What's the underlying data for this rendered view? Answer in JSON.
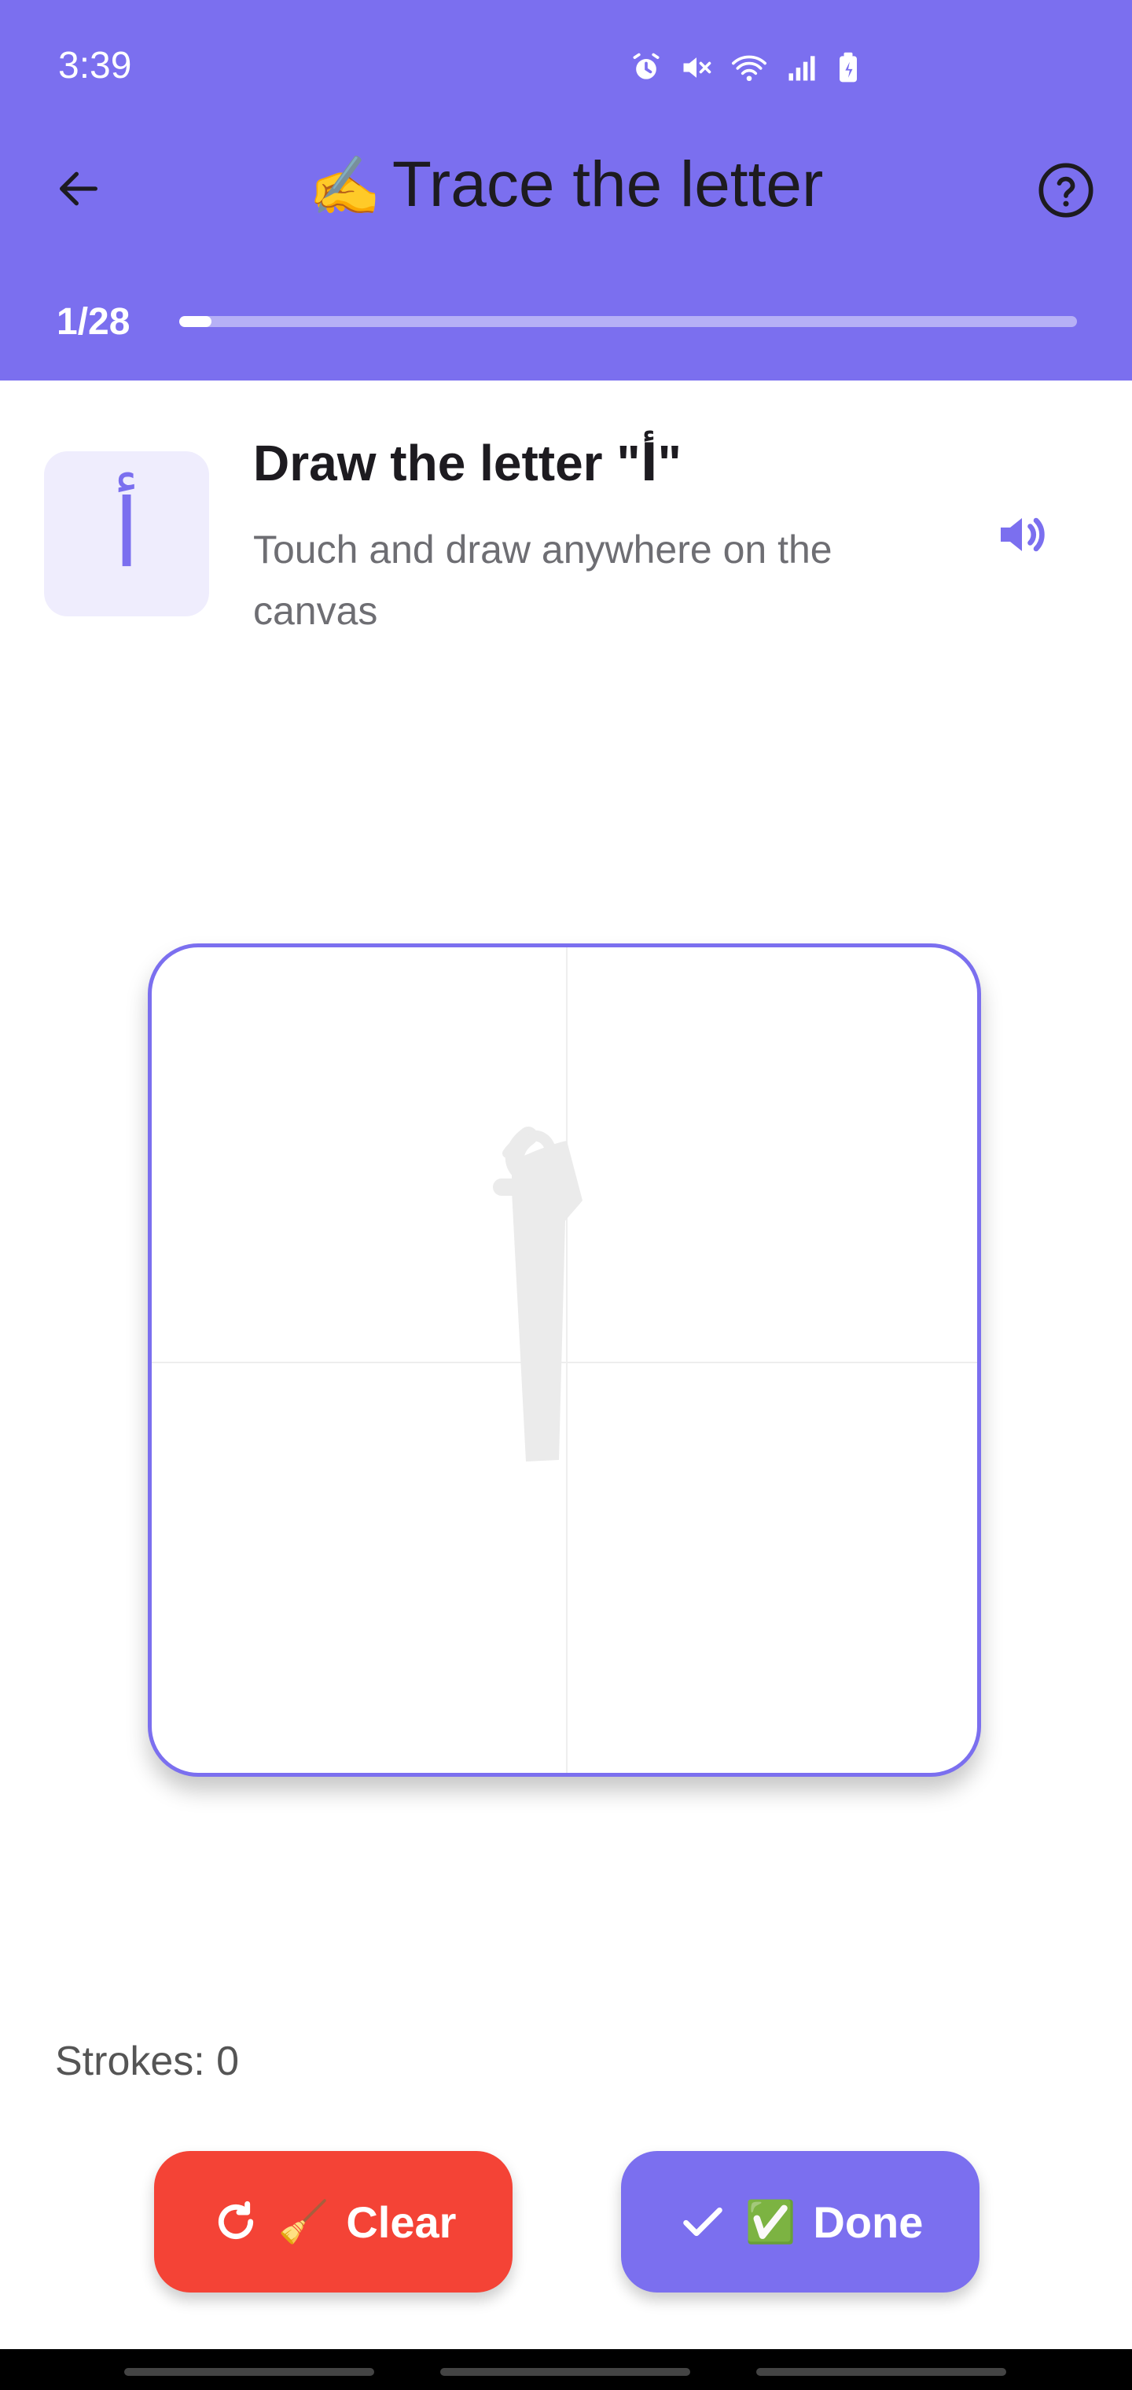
{
  "status_bar": {
    "time": "3:39",
    "icons": [
      "alarm-icon",
      "mute-icon",
      "wifi-icon",
      "signal-icon",
      "battery-icon"
    ]
  },
  "app_bar": {
    "title_emoji": "✍️",
    "title_text": "Trace the letter",
    "back_icon": "arrow-left-icon",
    "help_icon": "help-circle-icon"
  },
  "progress": {
    "label": "1/28",
    "current": 1,
    "total": 28
  },
  "instruction": {
    "letter": "أ",
    "title": "Draw the letter \"أ\"",
    "subtitle": "Touch and draw anywhere on the canvas",
    "speaker_icon": "speaker-icon"
  },
  "canvas": {
    "guide_letter": "أ"
  },
  "strokes": {
    "label": "Strokes: 0"
  },
  "buttons": {
    "clear_emoji": "🧹",
    "clear_label": "Clear",
    "done_emoji": "✅",
    "done_label": "Done"
  },
  "colors": {
    "primary": "#7B6FEF",
    "danger": "#F44336",
    "tile_bg": "#EFEDFD"
  }
}
